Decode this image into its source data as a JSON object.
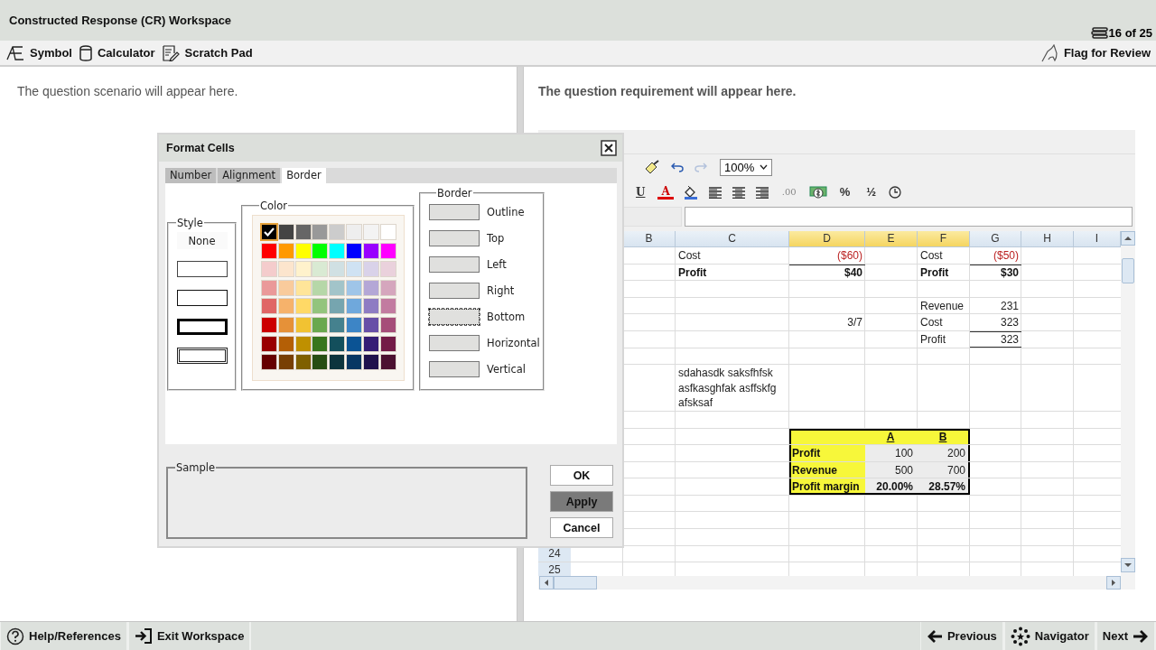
{
  "window": {
    "title": "Constructed Response (CR) Workspace",
    "progress": "16 of 25"
  },
  "toolbar": {
    "tools": [
      {
        "label": "Symbol",
        "kind": "symbol"
      },
      {
        "label": "Calculator",
        "kind": "calculator"
      },
      {
        "label": "Scratch Pad",
        "kind": "scratchpad"
      }
    ],
    "flag": "Flag for Review"
  },
  "scenario": {
    "text": "The question scenario will appear here."
  },
  "requirement": {
    "text": "The question requirement will appear here."
  },
  "spreadsheet": {
    "quick_tools": [
      {
        "kind": "brush"
      },
      {
        "kind": "undo",
        "disabled": false
      },
      {
        "kind": "redo",
        "disabled": true
      }
    ],
    "zoom": "100%",
    "format_tools": [
      {
        "kind": "underline",
        "label": "U"
      },
      {
        "kind": "font-color",
        "label": "A"
      },
      {
        "kind": "fill"
      },
      {
        "kind": "align-left"
      },
      {
        "kind": "align-center"
      },
      {
        "kind": "align-right"
      },
      {
        "kind": "decimals",
        "label": ".00"
      },
      {
        "kind": "currency"
      },
      {
        "kind": "percent",
        "label": "%"
      },
      {
        "kind": "fraction",
        "label": "½"
      },
      {
        "kind": "time"
      }
    ],
    "columns": [
      {
        "label": "B",
        "highlighted": false
      },
      {
        "label": "C",
        "highlighted": false
      },
      {
        "label": "D",
        "highlighted": true
      },
      {
        "label": "E",
        "highlighted": true
      },
      {
        "label": "F",
        "highlighted": true
      },
      {
        "label": "G",
        "highlighted": false
      },
      {
        "label": "H",
        "highlighted": false
      },
      {
        "label": "I",
        "highlighted": false
      }
    ],
    "rows": [
      {
        "kind": "filled",
        "cells": [
          {
            "kind": "blank"
          },
          {
            "kind": "label",
            "text": "Cost"
          },
          {
            "kind": "negative",
            "text": "($60)"
          },
          {
            "kind": "blank"
          },
          {
            "kind": "label",
            "text": "Cost"
          },
          {
            "kind": "negative",
            "text": "($50)"
          }
        ]
      },
      {
        "kind": "filled",
        "cells": [
          {
            "kind": "blank"
          },
          {
            "kind": "strong",
            "text": "Profit"
          },
          {
            "kind": "total",
            "text": "$40",
            "rule_above": true
          },
          {
            "kind": "blank"
          },
          {
            "kind": "strong",
            "text": "Profit"
          },
          {
            "kind": "total",
            "text": "$30",
            "rule_above": true
          }
        ]
      },
      {
        "kind": "empty"
      },
      {
        "kind": "filled",
        "cells": [
          {
            "kind": "blank"
          },
          {
            "kind": "blank"
          },
          {
            "kind": "blank"
          },
          {
            "kind": "blank"
          },
          {
            "kind": "label",
            "text": "Revenue"
          },
          {
            "kind": "amount",
            "text": "231"
          }
        ]
      },
      {
        "kind": "filled",
        "cells": [
          {
            "kind": "blank"
          },
          {
            "kind": "blank"
          },
          {
            "kind": "amount",
            "text": "3/7"
          },
          {
            "kind": "blank"
          },
          {
            "kind": "label",
            "text": "Cost"
          },
          {
            "kind": "amount",
            "text": "323"
          }
        ]
      },
      {
        "kind": "filled",
        "cells": [
          {
            "kind": "blank"
          },
          {
            "kind": "blank"
          },
          {
            "kind": "blank"
          },
          {
            "kind": "blank"
          },
          {
            "kind": "label",
            "text": "Profit"
          },
          {
            "kind": "amount",
            "text": "323",
            "rule_above": true,
            "rule_below": true
          }
        ]
      },
      {
        "kind": "empty"
      },
      {
        "kind": "filled",
        "cells": [
          {
            "kind": "blank"
          },
          {
            "kind": "label",
            "text": "sdahasdk saksfhfsk asfkasghfak asffskfg afsksaf"
          }
        ]
      },
      {
        "kind": "empty"
      },
      {
        "kind": "filled",
        "cells": [
          {
            "kind": "blank"
          },
          {
            "kind": "blank"
          },
          {
            "kind": "blank",
            "color": "#f7f73a",
            "framed": true
          },
          {
            "kind": "heading",
            "text": "A",
            "color": "#f7f73a",
            "framed": true
          },
          {
            "kind": "heading",
            "text": "B",
            "color": "#f7f73a",
            "framed": true
          }
        ]
      },
      {
        "kind": "filled",
        "cells": [
          {
            "kind": "blank"
          },
          {
            "kind": "blank"
          },
          {
            "kind": "strong",
            "text": "Profit",
            "color": "#f7f73a",
            "framed": true
          },
          {
            "kind": "amount",
            "text": "100",
            "color": "#ececec",
            "framed": true
          },
          {
            "kind": "amount",
            "text": "200",
            "color": "#ececec",
            "framed": true
          }
        ]
      },
      {
        "kind": "filled",
        "cells": [
          {
            "kind": "blank"
          },
          {
            "kind": "blank"
          },
          {
            "kind": "strong",
            "text": "Revenue",
            "color": "#f7f73a",
            "framed": true
          },
          {
            "kind": "amount",
            "text": "500",
            "color": "#ececec",
            "framed": true
          },
          {
            "kind": "amount",
            "text": "700",
            "color": "#ececec",
            "framed": true
          }
        ]
      },
      {
        "kind": "filled",
        "cells": [
          {
            "kind": "blank"
          },
          {
            "kind": "blank"
          },
          {
            "kind": "strong",
            "text": "Profit margin",
            "color": "#f7f73a",
            "framed": true
          },
          {
            "kind": "total",
            "text": "20.00%",
            "color": "#ececec",
            "framed": true
          },
          {
            "kind": "total",
            "text": "28.57%",
            "color": "#ececec",
            "framed": true
          }
        ]
      },
      {
        "kind": "empty"
      },
      {
        "kind": "empty"
      },
      {
        "kind": "empty"
      },
      {
        "kind": "empty",
        "label": "24"
      },
      {
        "kind": "empty",
        "label": "25"
      }
    ]
  },
  "dialog": {
    "title": "Format Cells",
    "tabs": [
      {
        "label": "Number",
        "selected": false
      },
      {
        "label": "Alignment",
        "selected": false
      },
      {
        "label": "Border",
        "selected": true
      }
    ],
    "style": {
      "legend": "Style",
      "options": [
        {
          "kind": "none",
          "label": "None"
        },
        {
          "kind": "dotted"
        },
        {
          "kind": "thin"
        },
        {
          "kind": "thick"
        },
        {
          "kind": "double"
        }
      ]
    },
    "color": {
      "legend": "Color",
      "swatches": [
        [
          {
            "color": "#000000",
            "selected": true
          },
          {
            "color": "#444444",
            "selected": false
          },
          {
            "color": "#666666",
            "selected": false
          },
          {
            "color": "#999999",
            "selected": false
          },
          {
            "color": "#cccccc",
            "selected": false
          },
          {
            "color": "#eeeeee",
            "selected": false
          },
          {
            "color": "#f3f3f3",
            "selected": false
          },
          {
            "color": "#ffffff",
            "selected": false
          }
        ],
        [
          {
            "color": "#ff0000",
            "selected": false
          },
          {
            "color": "#ff9900",
            "selected": false
          },
          {
            "color": "#ffff00",
            "selected": false
          },
          {
            "color": "#00ff00",
            "selected": false
          },
          {
            "color": "#00ffff",
            "selected": false
          },
          {
            "color": "#0000ff",
            "selected": false
          },
          {
            "color": "#9900ff",
            "selected": false
          },
          {
            "color": "#ff00ff",
            "selected": false
          }
        ],
        [
          {
            "color": "#f4cccc",
            "selected": false
          },
          {
            "color": "#fce5cd",
            "selected": false
          },
          {
            "color": "#fff2cc",
            "selected": false
          },
          {
            "color": "#d9ead3",
            "selected": false
          },
          {
            "color": "#d0e0e3",
            "selected": false
          },
          {
            "color": "#cfe2f3",
            "selected": false
          },
          {
            "color": "#d9d2e9",
            "selected": false
          },
          {
            "color": "#ead1dc",
            "selected": false
          }
        ],
        [
          {
            "color": "#ea9999",
            "selected": false
          },
          {
            "color": "#f9cb9c",
            "selected": false
          },
          {
            "color": "#ffe599",
            "selected": false
          },
          {
            "color": "#b6d7a8",
            "selected": false
          },
          {
            "color": "#a2c4c9",
            "selected": false
          },
          {
            "color": "#9fc5e8",
            "selected": false
          },
          {
            "color": "#b4a7d6",
            "selected": false
          },
          {
            "color": "#d5a6bd",
            "selected": false
          }
        ],
        [
          {
            "color": "#e06666",
            "selected": false
          },
          {
            "color": "#f6b26b",
            "selected": false
          },
          {
            "color": "#ffd966",
            "selected": false
          },
          {
            "color": "#93c47d",
            "selected": false
          },
          {
            "color": "#76a5af",
            "selected": false
          },
          {
            "color": "#6fa8dc",
            "selected": false
          },
          {
            "color": "#8e7cc3",
            "selected": false
          },
          {
            "color": "#c27ba0",
            "selected": false
          }
        ],
        [
          {
            "color": "#cc0000",
            "selected": false
          },
          {
            "color": "#e69138",
            "selected": false
          },
          {
            "color": "#f1c232",
            "selected": false
          },
          {
            "color": "#6aa84f",
            "selected": false
          },
          {
            "color": "#45818e",
            "selected": false
          },
          {
            "color": "#3d85c6",
            "selected": false
          },
          {
            "color": "#674ea7",
            "selected": false
          },
          {
            "color": "#a64d79",
            "selected": false
          }
        ],
        [
          {
            "color": "#990000",
            "selected": false
          },
          {
            "color": "#b45f06",
            "selected": false
          },
          {
            "color": "#bf9000",
            "selected": false
          },
          {
            "color": "#38761d",
            "selected": false
          },
          {
            "color": "#134f5c",
            "selected": false
          },
          {
            "color": "#0b5394",
            "selected": false
          },
          {
            "color": "#351c75",
            "selected": false
          },
          {
            "color": "#741b47",
            "selected": false
          }
        ],
        [
          {
            "color": "#660000",
            "selected": false
          },
          {
            "color": "#783f04",
            "selected": false
          },
          {
            "color": "#7f6000",
            "selected": false
          },
          {
            "color": "#274e13",
            "selected": false
          },
          {
            "color": "#0c343d",
            "selected": false
          },
          {
            "color": "#073763",
            "selected": false
          },
          {
            "color": "#20124d",
            "selected": false
          },
          {
            "color": "#4c1130",
            "selected": false
          }
        ]
      ]
    },
    "border": {
      "legend": "Border",
      "options": [
        {
          "label": "Outline",
          "focused": false
        },
        {
          "label": "Top",
          "focused": false
        },
        {
          "label": "Left",
          "focused": false
        },
        {
          "label": "Right",
          "focused": false
        },
        {
          "label": "Bottom",
          "focused": true
        },
        {
          "label": "Horizontal",
          "focused": false
        },
        {
          "label": "Vertical",
          "focused": false
        }
      ]
    },
    "sample": {
      "legend": "Sample"
    },
    "buttons": [
      {
        "label": "OK",
        "kind": "plain"
      },
      {
        "label": "Apply",
        "kind": "default"
      },
      {
        "label": "Cancel",
        "kind": "plain"
      }
    ]
  },
  "footer": {
    "left": [
      {
        "label": "Help/References",
        "kind": "help"
      },
      {
        "label": "Exit Workspace",
        "kind": "exit"
      }
    ],
    "right": [
      {
        "label": "Previous",
        "kind": "previous"
      },
      {
        "label": "Navigator",
        "kind": "navigator"
      },
      {
        "label": "Next",
        "kind": "next"
      }
    ]
  }
}
